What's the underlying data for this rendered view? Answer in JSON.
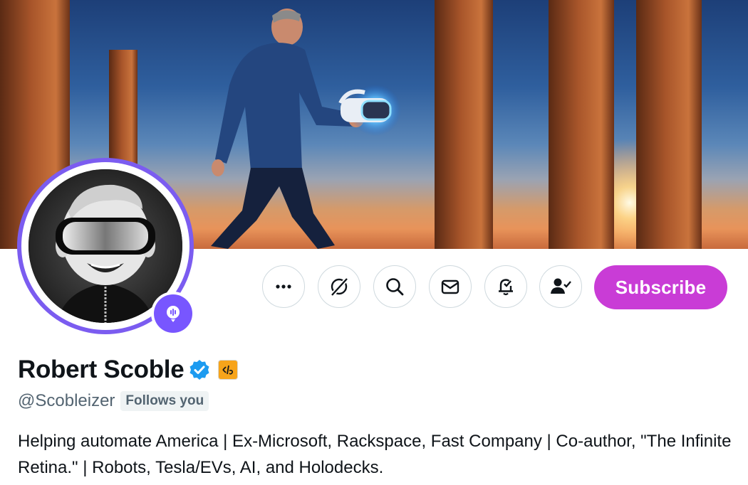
{
  "profile": {
    "name": "Robert Scoble",
    "handle": "@Scobleizer",
    "follows_badge": "Follows you",
    "bio": "Helping automate America | Ex-Microsoft, Rackspace, Fast Company | Co-author, \"The Infinite Retina.\" | Robots, Tesla/EVs, AI, and Holodecks.",
    "verified": true,
    "affiliate_badge_icon": "affiliate-logo-icon"
  },
  "actions": {
    "more_icon": "more-icon",
    "grok_icon": "grok-icon",
    "search_icon": "search-icon",
    "message_icon": "message-icon",
    "notify_icon": "bell-check-icon",
    "following_icon": "person-check-icon",
    "subscribe_label": "Subscribe"
  },
  "colors": {
    "subscribe_bg": "#c93cd6",
    "avatar_ring": "#7b5cf0",
    "verified_blue": "#1d9bf0",
    "affiliate_orange": "#f7a41a",
    "secondary_text": "#536471"
  }
}
